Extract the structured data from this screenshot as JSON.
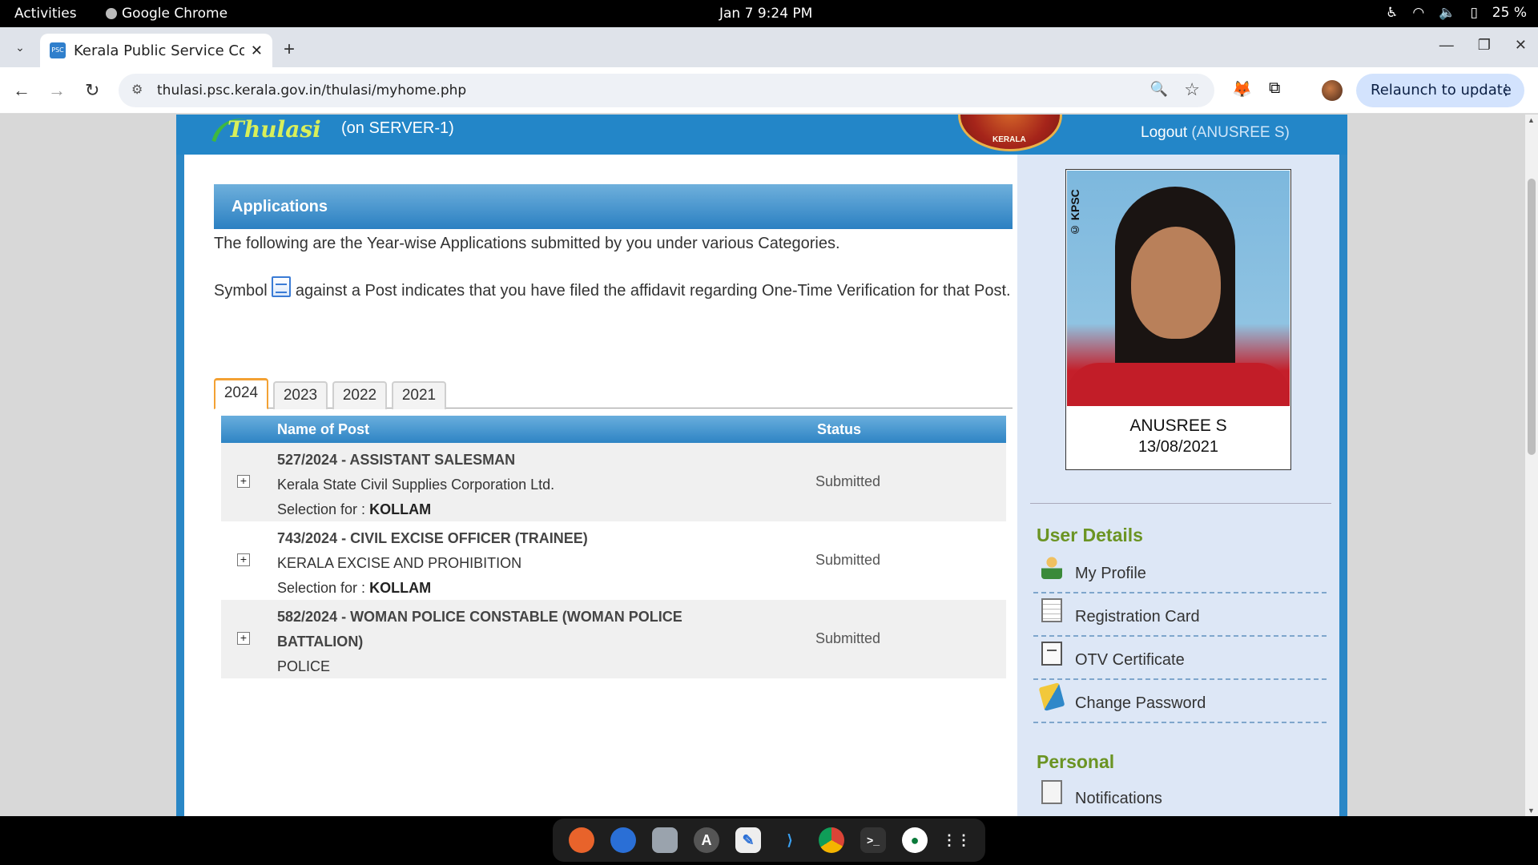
{
  "topbar": {
    "activities": "Activities",
    "app_name": "Google Chrome",
    "clock": "Jan 7  9:24 PM",
    "battery": "25 %"
  },
  "browser": {
    "tab_title": "Kerala Public Service Commission",
    "url": "thulasi.psc.kerala.gov.in/thulasi/myhome.php",
    "relaunch": "Relaunch to update"
  },
  "header": {
    "logo_text": "Thulasi",
    "server": "(on SERVER-1)",
    "emblem_text": "KERALA",
    "logout_label": "Logout",
    "logout_user": "(ANUSREE S)"
  },
  "applications": {
    "heading": "Applications",
    "intro": "The following are the Year-wise Applications submitted by you under various Categories.",
    "symbol_before": "Symbol",
    "symbol_after": "against a Post indicates that you have filed the affidavit regarding One-Time Verification for that Post.",
    "years": [
      "2024",
      "2023",
      "2022",
      "2021"
    ],
    "active_year": "2024",
    "columns": {
      "name": "Name of Post",
      "status": "Status"
    },
    "rows": [
      {
        "post": "527/2024 - ASSISTANT SALESMAN",
        "org": "Kerala State Civil Supplies Corporation Ltd.",
        "selection_label": "Selection for :",
        "selection": "KOLLAM",
        "status": "Submitted"
      },
      {
        "post": "743/2024 - CIVIL EXCISE OFFICER (TRAINEE)",
        "org": "KERALA EXCISE AND PROHIBITION",
        "selection_label": "Selection for :",
        "selection": "KOLLAM",
        "status": "Submitted"
      },
      {
        "post": "582/2024 - WOMAN POLICE CONSTABLE (WOMAN POLICE BATTALION)",
        "org": "POLICE",
        "status": "Submitted"
      }
    ]
  },
  "sidebar": {
    "photo_watermark": "© KPSC",
    "name": "ANUSREE S",
    "date": "13/08/2021",
    "user_details_title": "User Details",
    "user_details": [
      {
        "label": "My Profile",
        "icon": "profile-icon"
      },
      {
        "label": "Registration Card",
        "icon": "card-icon"
      },
      {
        "label": "OTV Certificate",
        "icon": "certificate-icon"
      },
      {
        "label": "Change Password",
        "icon": "password-icon"
      }
    ],
    "personal_title": "Personal",
    "personal": [
      {
        "label": "Notifications",
        "icon": "notification-icon"
      }
    ]
  },
  "colors": {
    "brand_blue": "#2386c8",
    "sidebar_bg": "#dde7f6",
    "section_green": "#6b9423",
    "active_tab_accent": "#f3a133"
  }
}
